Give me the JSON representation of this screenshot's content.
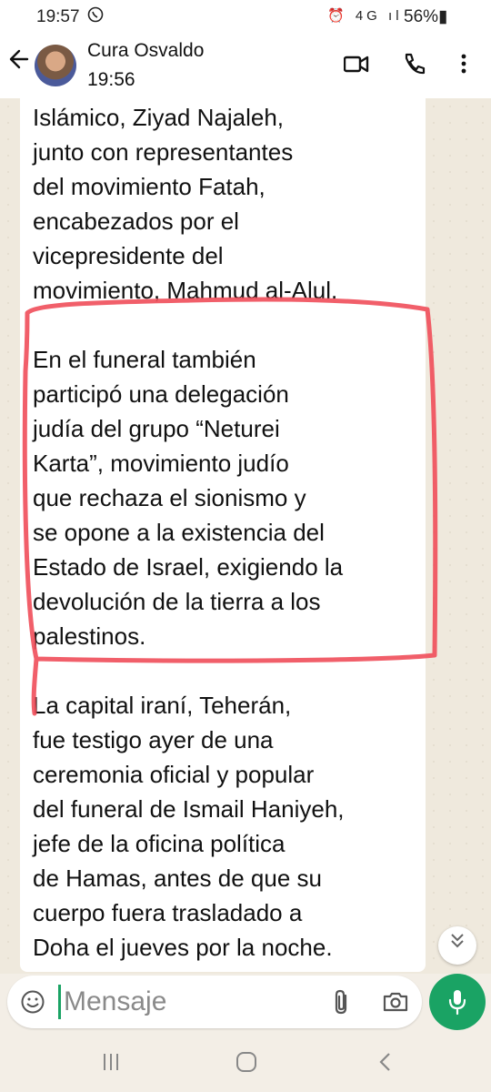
{
  "status_bar": {
    "time": "19:57",
    "left_icon": "whatsapp-icon",
    "indicators": "⏰ 4G ıl",
    "battery": "56%▮"
  },
  "header": {
    "contact_name": "Cura Osvaldo",
    "status": "19:56",
    "icons": [
      "back-arrow-icon",
      "video-call-icon",
      "voice-call-icon",
      "more-options-icon"
    ]
  },
  "message": {
    "lines": [
      "Islámico, Ziyad Najaleh,",
      "junto con representantes",
      "del movimiento Fatah,",
      "encabezados por el",
      "vicepresidente del",
      "movimiento, Mahmud al-Alul.",
      "",
      "En el funeral también",
      "participó una delegación",
      "judía del grupo “Neturei",
      "Karta”, movimiento judío",
      "que rechaza el sionismo y",
      "se opone a la existencia del",
      "Estado de Israel, exigiendo la",
      "devolución de la tierra a los",
      "palestinos.",
      "",
      "La capital iraní, Teherán,",
      "fue testigo ayer de una",
      "ceremonia oficial y popular",
      "del funeral de Ismail Haniyeh,",
      "jefe de la oficina política",
      "de Hamas, antes de que su",
      "cuerpo fuera trasladado a",
      "Doha el jueves por la noche."
    ],
    "highlight_color": "#f04e5a"
  },
  "scroll_down": {
    "icon": "double-chevron-down-icon",
    "glyph": "⌄"
  },
  "composer": {
    "placeholder": "Mensaje",
    "icons": [
      "emoji-icon",
      "attach-icon",
      "camera-icon",
      "mic-icon"
    ],
    "accent_color": "#1aa364"
  },
  "nav_bar": {
    "recents": "|||",
    "home": "◯",
    "back": "<"
  }
}
